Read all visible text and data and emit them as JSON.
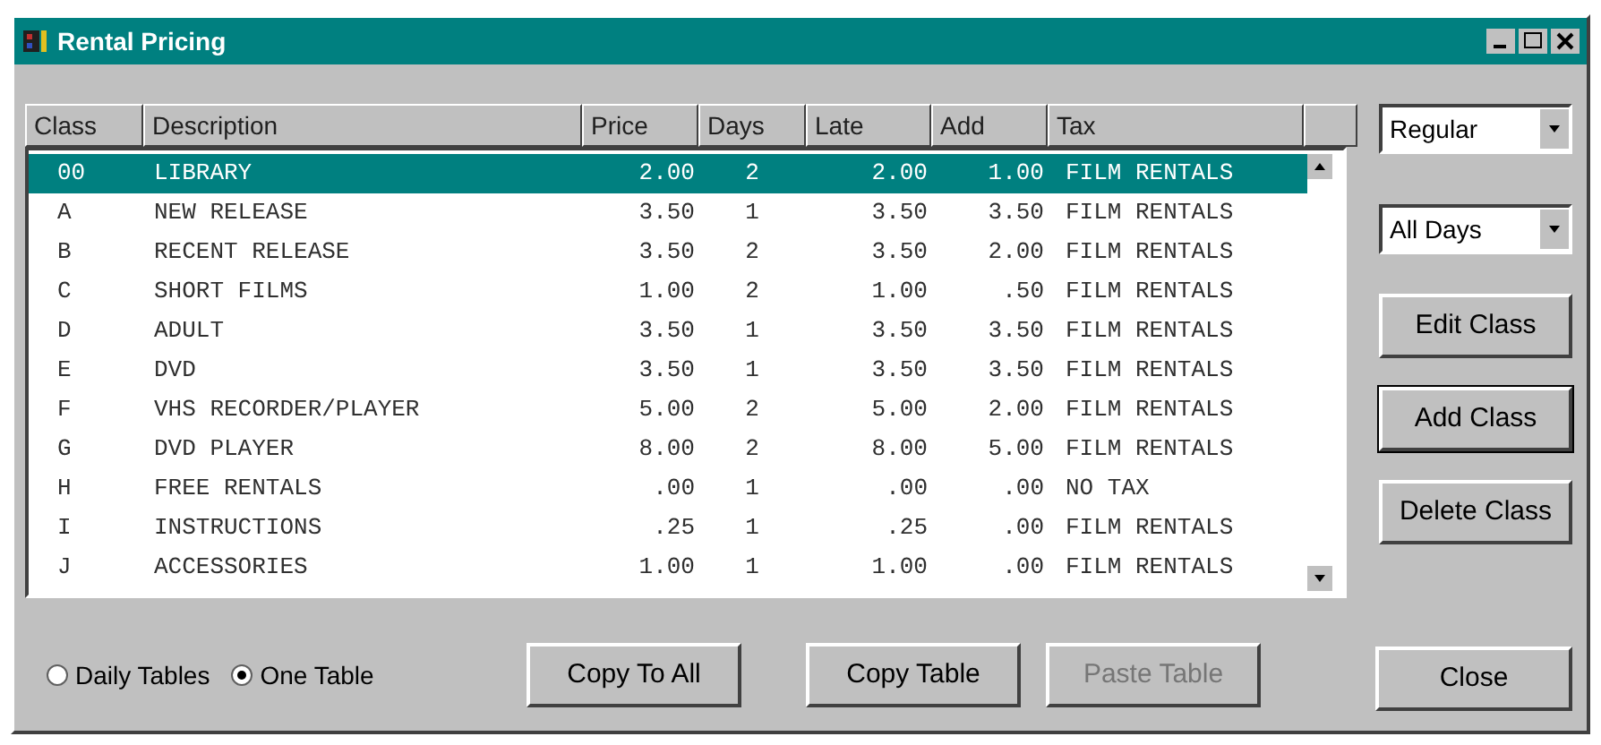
{
  "window": {
    "title": "Rental Pricing"
  },
  "table": {
    "columns": [
      "Class",
      "Description",
      "Price",
      "Days",
      "Late",
      "Add",
      "Tax"
    ],
    "rows": [
      {
        "cells": [
          "00",
          "LIBRARY",
          "2.00",
          "2",
          "2.00",
          "1.00",
          "FILM RENTALS"
        ],
        "selected": true
      },
      {
        "cells": [
          "A",
          "NEW RELEASE",
          "3.50",
          "1",
          "3.50",
          "3.50",
          "FILM RENTALS"
        ],
        "selected": false
      },
      {
        "cells": [
          "B",
          "RECENT RELEASE",
          "3.50",
          "2",
          "3.50",
          "2.00",
          "FILM RENTALS"
        ],
        "selected": false
      },
      {
        "cells": [
          "C",
          "SHORT FILMS",
          "1.00",
          "2",
          "1.00",
          ".50",
          "FILM RENTALS"
        ],
        "selected": false
      },
      {
        "cells": [
          "D",
          "ADULT",
          "3.50",
          "1",
          "3.50",
          "3.50",
          "FILM RENTALS"
        ],
        "selected": false
      },
      {
        "cells": [
          "E",
          "DVD",
          "3.50",
          "1",
          "3.50",
          "3.50",
          "FILM RENTALS"
        ],
        "selected": false
      },
      {
        "cells": [
          "F",
          "VHS RECORDER/PLAYER",
          "5.00",
          "2",
          "5.00",
          "2.00",
          "FILM RENTALS"
        ],
        "selected": false
      },
      {
        "cells": [
          "G",
          "DVD PLAYER",
          "8.00",
          "2",
          "8.00",
          "5.00",
          "FILM RENTALS"
        ],
        "selected": false
      },
      {
        "cells": [
          "H",
          "FREE RENTALS",
          ".00",
          "1",
          ".00",
          ".00",
          "NO TAX"
        ],
        "selected": false
      },
      {
        "cells": [
          "I",
          "INSTRUCTIONS",
          ".25",
          "1",
          ".25",
          ".00",
          "FILM RENTALS"
        ],
        "selected": false
      },
      {
        "cells": [
          "J",
          "ACCESSORIES",
          "1.00",
          "1",
          "1.00",
          ".00",
          "FILM RENTALS"
        ],
        "selected": false
      }
    ]
  },
  "dropdowns": [
    {
      "value": "Regular"
    },
    {
      "value": "All Days"
    }
  ],
  "side_buttons": [
    {
      "label": "Edit Class",
      "focused": false
    },
    {
      "label": "Add Class",
      "focused": true
    },
    {
      "label": "Delete Class",
      "focused": false
    }
  ],
  "radios": [
    {
      "label": "Daily Tables",
      "selected": false
    },
    {
      "label": "One Table",
      "selected": true
    }
  ],
  "bottom_buttons": [
    {
      "label": "Copy To All",
      "disabled": false
    },
    {
      "label": "Copy Table",
      "disabled": false
    },
    {
      "label": "Paste Table",
      "disabled": true
    }
  ],
  "close_button": {
    "label": "Close"
  }
}
